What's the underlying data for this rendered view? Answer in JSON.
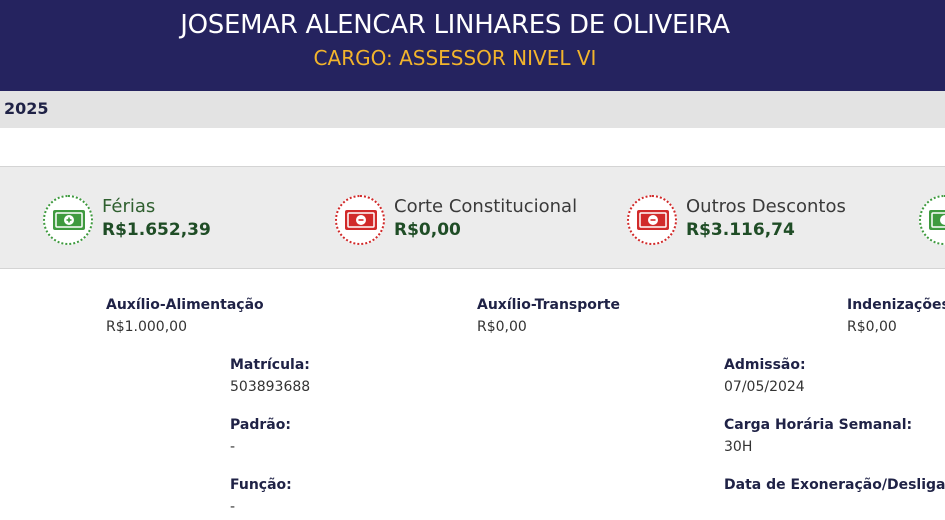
{
  "header": {
    "name": "JOSEMAR ALENCAR LINHARES DE OLIVEIRA",
    "role": "CARGO: ASSESSOR NIVEL VI"
  },
  "year_bar": {
    "year": "2025"
  },
  "summary_cards": [
    {
      "title": "Férias",
      "value": "R$1.652,39",
      "icon": "money-plus-icon",
      "kind": "positive"
    },
    {
      "title": "Corte Constitucional",
      "value": "R$0,00",
      "icon": "money-minus-icon",
      "kind": "negative"
    },
    {
      "title": "Outros Descontos",
      "value": "R$3.116,74",
      "icon": "money-minus-icon",
      "kind": "negative"
    },
    {
      "title": "",
      "value": "",
      "icon": "money-plus-icon",
      "kind": "positive"
    }
  ],
  "benefits": [
    {
      "label": "Auxílio-Alimentação",
      "value": "R$1.000,00"
    },
    {
      "label": "Auxílio-Transporte",
      "value": "R$0,00"
    },
    {
      "label": "Indenizações",
      "value": "R$0,00"
    }
  ],
  "details": {
    "matricula": {
      "label": "Matrícula:",
      "value": "503893688"
    },
    "padrao": {
      "label": "Padrão:",
      "value": "-"
    },
    "funcao": {
      "label": "Função:",
      "value": "-"
    },
    "admissao": {
      "label": "Admissão:",
      "value": "07/05/2024"
    },
    "carga_horaria": {
      "label": "Carga Horária Semanal:",
      "value": "30H"
    },
    "exoneracao": {
      "label": "Data de Exoneração/Desligam",
      "value": ""
    }
  },
  "colors": {
    "header_bg": "#25235f",
    "role_text": "#f2b42c",
    "positive": "#3f9a3f",
    "negative": "#d12a2a",
    "value_text": "#1f4d26"
  }
}
